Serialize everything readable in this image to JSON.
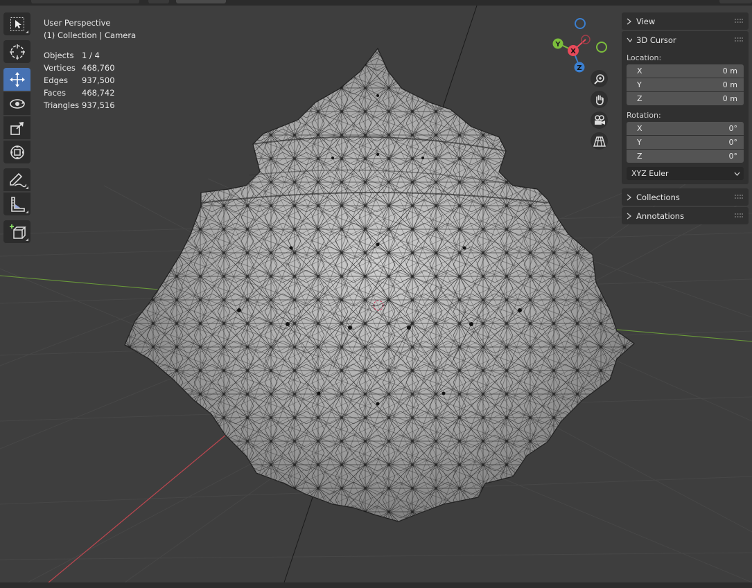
{
  "viewport": {
    "view_name": "User Perspective",
    "collection_line": "(1) Collection | Camera"
  },
  "stats": [
    {
      "label": "Objects",
      "value": "1 / 4"
    },
    {
      "label": "Vertices",
      "value": "468,760"
    },
    {
      "label": "Edges",
      "value": "937,500"
    },
    {
      "label": "Faces",
      "value": "468,742"
    },
    {
      "label": "Triangles",
      "value": "937,516"
    }
  ],
  "toolbar": {
    "tools": [
      {
        "name": "select-box-tool",
        "icon": "cursor-select-icon",
        "active": false
      },
      {
        "name": "cursor-tool",
        "icon": "3d-cursor-icon",
        "active": false
      },
      {
        "name": "move-tool",
        "icon": "move-arrows-icon",
        "active": true
      },
      {
        "name": "rotate-tool",
        "icon": "rotate-icon",
        "active": false
      },
      {
        "name": "scale-tool",
        "icon": "scale-icon",
        "active": false
      },
      {
        "name": "transform-tool",
        "icon": "transform-icon",
        "active": false
      },
      {
        "name": "annotate-tool",
        "icon": "annotate-pen-icon",
        "active": false
      },
      {
        "name": "measure-tool",
        "icon": "ruler-icon",
        "active": false
      },
      {
        "name": "add-cube-tool",
        "icon": "add-cube-icon",
        "active": false
      }
    ]
  },
  "gizmo": {
    "x_label": "X",
    "y_label": "Y",
    "z_label": "Z",
    "colors": {
      "x": "#e84a5a",
      "y": "#7cbe3c",
      "z": "#3b7fcf"
    }
  },
  "nav_buttons": [
    "zoom-icon",
    "hand-pan-icon",
    "camera-icon",
    "grid-perspective-icon"
  ],
  "sidebar": {
    "view_label": "View",
    "cursor_label": "3D Cursor",
    "location_label": "Location:",
    "location": [
      {
        "axis": "X",
        "value": "0 m"
      },
      {
        "axis": "Y",
        "value": "0 m"
      },
      {
        "axis": "Z",
        "value": "0 m"
      }
    ],
    "rotation_label": "Rotation:",
    "rotation": [
      {
        "axis": "X",
        "value": "0°"
      },
      {
        "axis": "Y",
        "value": "0°"
      },
      {
        "axis": "Z",
        "value": "0°"
      }
    ],
    "rotation_mode": "XYZ Euler",
    "collections_label": "Collections",
    "annotations_label": "Annotations"
  },
  "colors": {
    "accent": "#4772b3",
    "viewport_bg": "#3e3e3e",
    "x_axis_line": "#b9464f",
    "y_axis_line": "#6a9a3a"
  }
}
